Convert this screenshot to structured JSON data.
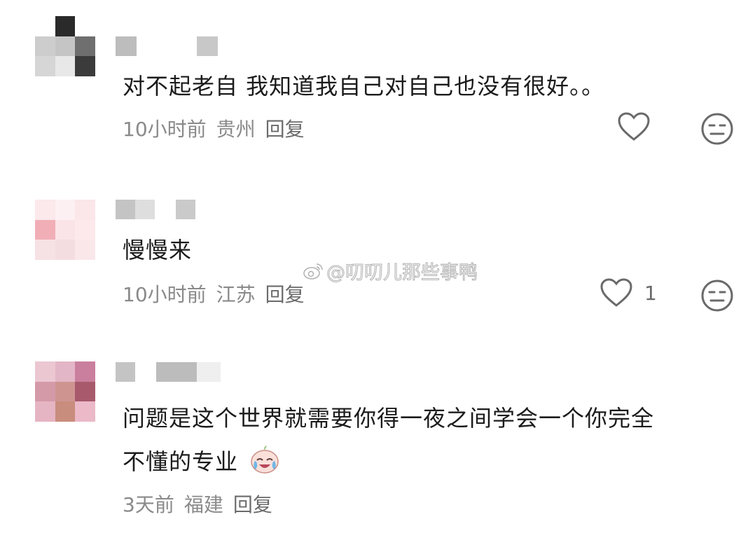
{
  "watermark": {
    "text": "@叨叨儿那些事鸭"
  },
  "comments": [
    {
      "text": "对不起老自 我知道我自己对自己也没有很好。。",
      "time": "10小时前",
      "location": "贵州",
      "reply_label": "回复",
      "like_count": "",
      "avatar_colors": [
        "#ffffff",
        "#2a2a2a",
        "#ffffff",
        "#cdcdcd",
        "#c5c5c5",
        "#6f6f6f",
        "#d6d6d6",
        "#e8e8e8",
        "#3b3b3b"
      ]
    },
    {
      "text": "慢慢来",
      "time": "10小时前",
      "location": "江苏",
      "reply_label": "回复",
      "like_count": "1",
      "avatar_colors": [
        "#fbe9ec",
        "#fdf0f2",
        "#fbe6ea",
        "#f1aeb7",
        "#fbe4e8",
        "#fde9ec",
        "#f6e1e4",
        "#f4dde1",
        "#f9e7ea"
      ]
    },
    {
      "text_line1": "问题是这个世界就需要你得一夜之间学会一个你完全",
      "text_line2": "不懂的专业",
      "time": "3天前",
      "location": "福建",
      "reply_label": "回复",
      "avatar_colors": [
        "#ebc7d2",
        "#e2b6c6",
        "#c97f9d",
        "#d59aa8",
        "#ce9590",
        "#a85a6c",
        "#e6b5c4",
        "#c98d7d",
        "#ebb9c8"
      ]
    }
  ],
  "icons": {
    "like": "heart-outline-icon",
    "dislike": "meh-face-icon",
    "emoji": "crying-laughing-emoji"
  }
}
